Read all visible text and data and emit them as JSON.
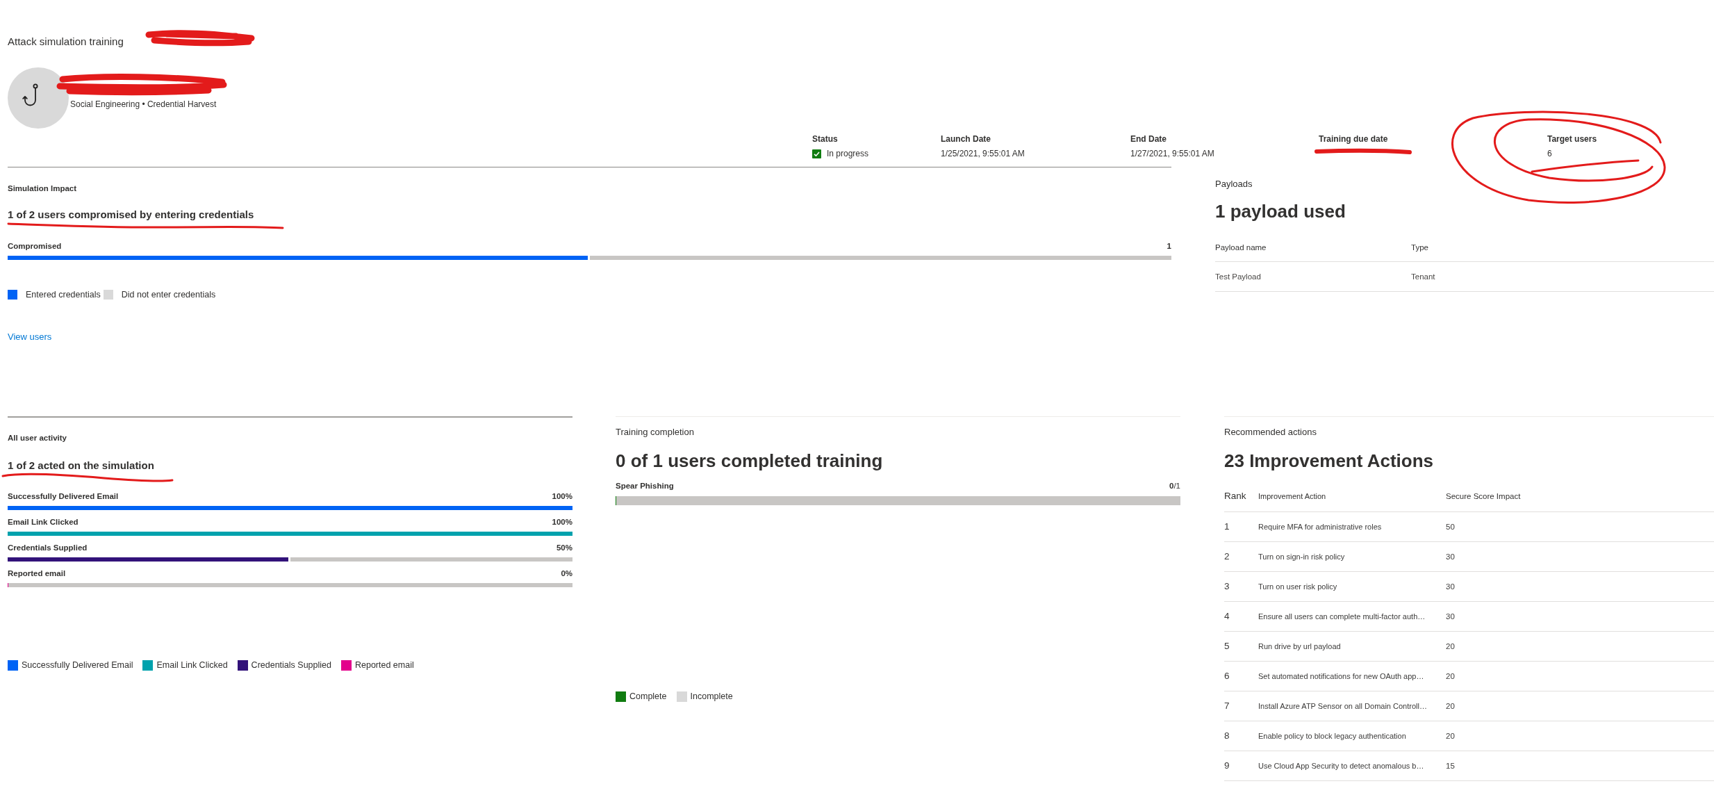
{
  "breadcrumb": {
    "label": "Attack simulation training"
  },
  "header": {
    "subtitle": "Social Engineering • Credential Harvest"
  },
  "details": [
    {
      "kind": "status",
      "label": "Status",
      "value": "In progress"
    },
    {
      "kind": "text",
      "label": "Launch Date",
      "value": "1/25/2021, 9:55:01 AM"
    },
    {
      "kind": "text",
      "label": "End Date",
      "value": "1/27/2021, 9:55:01 AM"
    },
    {
      "label": "Training due date"
    },
    {
      "kind": "text",
      "label": "Target users",
      "value": "6"
    }
  ],
  "simulation_impact": {
    "title": "Simulation Impact",
    "headline": "1 of 2 users compromised by entering credentials",
    "bar": {
      "label": "Compromised",
      "count": "1",
      "level": 0.5
    },
    "legend": [
      {
        "label": "Entered credentials",
        "color": "#0063f5"
      },
      {
        "label": "Did not enter credentials",
        "color": "#d9d9d9"
      }
    ],
    "link": "View users"
  },
  "payloads": {
    "title": "Payloads",
    "headline": "1 payload used",
    "columns": [
      "Payload name",
      "Type"
    ],
    "rows": [
      [
        "Test Payload",
        "Tenant"
      ]
    ]
  },
  "user_activity": {
    "title": "All user activity",
    "headline": "1 of 2 acted on the simulation",
    "metrics": [
      {
        "label": "Successfully Delivered Email",
        "value": "100%",
        "level": 1
      },
      {
        "label": "Email Link Clicked",
        "value": "100%",
        "level": 1
      },
      {
        "label": "Credentials Supplied",
        "value": "50%",
        "level": 0.5
      },
      {
        "label": "Reported email",
        "value": "0%",
        "level": 0
      }
    ],
    "legend": [
      {
        "label": "Successfully Delivered Email",
        "color": "#0063f5"
      },
      {
        "label": "Email Link Clicked",
        "color": "#00a2ad"
      },
      {
        "label": "Credentials Supplied",
        "color": "#32127a"
      },
      {
        "label": "Reported email",
        "color": "#e3008c"
      }
    ]
  },
  "training_completion": {
    "title": "Training completion",
    "headline": "0 of 1 users completed training",
    "trainings": [
      {
        "label": "Spear Phishing",
        "count": "**0**/1",
        "level": 0
      }
    ],
    "legend": [
      {
        "label": "Complete",
        "color": "#107c10"
      },
      {
        "label": "Incomplete",
        "color": "#d9d9d9"
      }
    ]
  },
  "recommended_actions": {
    "title": "Recommended actions",
    "headline": "23 Improvement Actions",
    "columns": [
      "Rank",
      "Improvement Action",
      "Secure Score Impact"
    ],
    "rows": [
      [
        "1",
        "Require MFA for administrative roles",
        "50"
      ],
      [
        "2",
        "Turn on sign-in risk policy",
        "30"
      ],
      [
        "3",
        "Turn on user risk policy",
        "30"
      ],
      [
        "4",
        "Ensure all users can complete multi-factor auth…",
        "30"
      ],
      [
        "5",
        "Run drive by url payload",
        "20"
      ],
      [
        "6",
        "Set automated notifications for new OAuth app…",
        "20"
      ],
      [
        "7",
        "Install Azure ATP Sensor on all Domain Controll…",
        "20"
      ],
      [
        "8",
        "Enable policy to block legacy authentication",
        "20"
      ],
      [
        "9",
        "Use Cloud App Security to detect anomalous b…",
        "15"
      ]
    ]
  }
}
